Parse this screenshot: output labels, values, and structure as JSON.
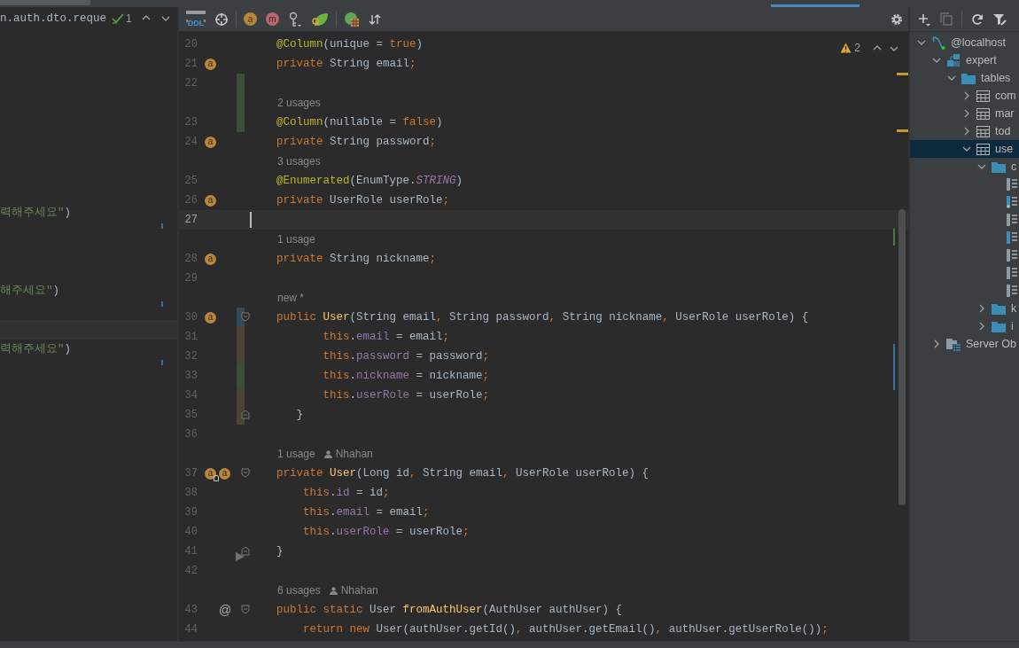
{
  "left_pane": {
    "path": "n.auth.dto.reque",
    "check_count": "1",
    "rows": [
      {
        "kind": "blank"
      },
      {
        "kind": "blank"
      },
      {
        "kind": "blank"
      },
      {
        "kind": "blank"
      },
      {
        "kind": "blank"
      },
      {
        "kind": "blank"
      },
      {
        "kind": "blank"
      },
      {
        "kind": "blank"
      },
      {
        "kind": "blank"
      },
      {
        "kind": "code",
        "tokens": [
          {
            "text": "력해주세요\"",
            "kind": "string"
          },
          {
            "text": ")",
            "kind": "plain"
          }
        ]
      },
      {
        "kind": "blank"
      },
      {
        "kind": "blank"
      },
      {
        "kind": "blank"
      },
      {
        "kind": "code",
        "tokens": [
          {
            "text": "해주세요\"",
            "kind": "string"
          },
          {
            "text": ")",
            "kind": "plain"
          }
        ]
      },
      {
        "kind": "blank"
      },
      {
        "kind": "caret_line"
      },
      {
        "kind": "code",
        "tokens": [
          {
            "text": "력해주세요\"",
            "kind": "string"
          },
          {
            "text": ")",
            "kind": "plain"
          }
        ]
      }
    ]
  },
  "toolbar": {
    "groups": [
      [
        {
          "kind": "ddl",
          "label": "DDL"
        },
        {
          "kind": "crosshair"
        }
      ],
      [
        {
          "kind": "bean",
          "label": "a"
        },
        {
          "kind": "method_bean",
          "label": "m"
        },
        {
          "kind": "key"
        },
        {
          "kind": "leaf"
        }
      ],
      [
        {
          "kind": "table_globe"
        },
        {
          "kind": "sort"
        }
      ]
    ]
  },
  "inspections": {
    "warning_count": "2"
  },
  "code_rows": [
    {
      "kind": "line",
      "number": "20",
      "current": false,
      "tokens": [
        {
          "text": "    @Column",
          "kind": "annotation"
        },
        {
          "text": "(unique = ",
          "kind": "plain"
        },
        {
          "text": "true",
          "kind": "keyword"
        },
        {
          "text": ")",
          "kind": "plain"
        }
      ]
    },
    {
      "kind": "line",
      "number": "21",
      "current": false,
      "gutter_icons": [
        {
          "kind": "bean",
          "label": "a"
        }
      ],
      "tokens": [
        {
          "text": "    private",
          "kind": "keyword"
        },
        {
          "text": " String email",
          "kind": "plain"
        },
        {
          "text": ";",
          "kind": "keyword"
        }
      ]
    },
    {
      "kind": "line",
      "number": "22",
      "current": false,
      "color": "#3a5038"
    },
    {
      "kind": "hint",
      "text": "2 usages",
      "color": "#3a5038"
    },
    {
      "kind": "line",
      "number": "23",
      "current": false,
      "color": "#3a5038",
      "tokens": [
        {
          "text": "    @Column",
          "kind": "annotation"
        },
        {
          "text": "(nullable = ",
          "kind": "plain"
        },
        {
          "text": "false",
          "kind": "keyword"
        },
        {
          "text": ")",
          "kind": "plain"
        }
      ]
    },
    {
      "kind": "line",
      "number": "24",
      "current": false,
      "gutter_icons": [
        {
          "kind": "bean",
          "label": "a"
        }
      ],
      "tokens": [
        {
          "text": "    private",
          "kind": "keyword"
        },
        {
          "text": " String password",
          "kind": "plain"
        },
        {
          "text": ";",
          "kind": "keyword"
        }
      ]
    },
    {
      "kind": "hint",
      "text": "3 usages"
    },
    {
      "kind": "line",
      "number": "25",
      "current": false,
      "tokens": [
        {
          "text": "    @Enumerated",
          "kind": "annotation"
        },
        {
          "text": "(EnumType.",
          "kind": "plain"
        },
        {
          "text": "STRING",
          "kind": "constant"
        },
        {
          "text": ")",
          "kind": "plain"
        }
      ]
    },
    {
      "kind": "line",
      "number": "26",
      "current": false,
      "gutter_icons": [
        {
          "kind": "bean",
          "label": "a"
        }
      ],
      "tokens": [
        {
          "text": "    private",
          "kind": "keyword"
        },
        {
          "text": " UserRole userRole",
          "kind": "plain"
        },
        {
          "text": ";",
          "kind": "keyword"
        }
      ]
    },
    {
      "kind": "line",
      "number": "27",
      "current": true
    },
    {
      "kind": "hint",
      "text": "1 usage"
    },
    {
      "kind": "line",
      "number": "28",
      "current": false,
      "gutter_icons": [
        {
          "kind": "bean",
          "label": "a"
        }
      ],
      "tokens": [
        {
          "text": "    private",
          "kind": "keyword"
        },
        {
          "text": " String nickname",
          "kind": "plain"
        },
        {
          "text": ";",
          "kind": "keyword"
        }
      ]
    },
    {
      "kind": "line",
      "number": "29",
      "current": false
    },
    {
      "kind": "hint",
      "text": "new *"
    },
    {
      "kind": "line",
      "number": "30",
      "current": false,
      "gutter_icons": [
        {
          "kind": "bean",
          "label": "a"
        }
      ],
      "color": "#34495a",
      "fold_start": true,
      "tokens": [
        {
          "text": "    public ",
          "kind": "keyword"
        },
        {
          "text": "User",
          "kind": "method"
        },
        {
          "text": "(String email",
          "kind": "plain"
        },
        {
          "text": ", ",
          "kind": "keyword"
        },
        {
          "text": "String password",
          "kind": "plain"
        },
        {
          "text": ", ",
          "kind": "keyword"
        },
        {
          "text": "String nickname",
          "kind": "plain"
        },
        {
          "text": ", ",
          "kind": "keyword"
        },
        {
          "text": "UserRole userRole) {",
          "kind": "plain"
        }
      ]
    },
    {
      "kind": "line",
      "number": "31",
      "current": false,
      "color": "#4b4534",
      "tokens": [
        {
          "text": "           this",
          "kind": "keyword"
        },
        {
          "text": ".",
          "kind": "plain"
        },
        {
          "text": "email",
          "kind": "field"
        },
        {
          "text": " = email",
          "kind": "plain"
        },
        {
          "text": ";",
          "kind": "keyword"
        }
      ]
    },
    {
      "kind": "line",
      "number": "32",
      "current": false,
      "color": "#4b4534",
      "tokens": [
        {
          "text": "           this",
          "kind": "keyword"
        },
        {
          "text": ".",
          "kind": "plain"
        },
        {
          "text": "password",
          "kind": "field"
        },
        {
          "text": " = password",
          "kind": "plain"
        },
        {
          "text": ";",
          "kind": "keyword"
        }
      ]
    },
    {
      "kind": "line",
      "number": "33",
      "current": false,
      "color": "#3a5038",
      "tokens": [
        {
          "text": "           this",
          "kind": "keyword"
        },
        {
          "text": ".",
          "kind": "plain"
        },
        {
          "text": "nickname",
          "kind": "field"
        },
        {
          "text": " = nickname",
          "kind": "plain"
        },
        {
          "text": ";",
          "kind": "keyword"
        }
      ]
    },
    {
      "kind": "line",
      "number": "34",
      "current": false,
      "color": "#4b4534",
      "tokens": [
        {
          "text": "           this",
          "kind": "keyword"
        },
        {
          "text": ".",
          "kind": "plain"
        },
        {
          "text": "userRole",
          "kind": "field"
        },
        {
          "text": " = userRole",
          "kind": "plain"
        },
        {
          "text": ";",
          "kind": "keyword"
        }
      ]
    },
    {
      "kind": "line",
      "number": "35",
      "current": false,
      "color": "#4b4534",
      "fold_end": true,
      "tokens": [
        {
          "text": "       }",
          "kind": "plain"
        }
      ]
    },
    {
      "kind": "line",
      "number": "36",
      "current": false
    },
    {
      "kind": "hint",
      "text": "1 usage",
      "author": "Nhahan"
    },
    {
      "kind": "line",
      "number": "37",
      "current": false,
      "gutter_icons": [
        {
          "kind": "bean_key",
          "label": "a"
        },
        {
          "kind": "bean",
          "label": "a"
        }
      ],
      "fold_start": true,
      "tokens": [
        {
          "text": "    private ",
          "kind": "keyword"
        },
        {
          "text": "User",
          "kind": "method"
        },
        {
          "text": "(Long id",
          "kind": "plain"
        },
        {
          "text": ", ",
          "kind": "keyword"
        },
        {
          "text": "String email",
          "kind": "plain"
        },
        {
          "text": ", ",
          "kind": "keyword"
        },
        {
          "text": "UserRole userRole) {",
          "kind": "plain"
        }
      ]
    },
    {
      "kind": "line",
      "number": "38",
      "current": false,
      "tokens": [
        {
          "text": "        this",
          "kind": "keyword"
        },
        {
          "text": ".",
          "kind": "plain"
        },
        {
          "text": "id",
          "kind": "field"
        },
        {
          "text": " = id",
          "kind": "plain"
        },
        {
          "text": ";",
          "kind": "keyword"
        }
      ]
    },
    {
      "kind": "line",
      "number": "39",
      "current": false,
      "tokens": [
        {
          "text": "        this",
          "kind": "keyword"
        },
        {
          "text": ".",
          "kind": "plain"
        },
        {
          "text": "email",
          "kind": "field"
        },
        {
          "text": " = email",
          "kind": "plain"
        },
        {
          "text": ";",
          "kind": "keyword"
        }
      ]
    },
    {
      "kind": "line",
      "number": "40",
      "current": false,
      "tokens": [
        {
          "text": "        this",
          "kind": "keyword"
        },
        {
          "text": ".",
          "kind": "plain"
        },
        {
          "text": "userRole",
          "kind": "field"
        },
        {
          "text": " = userRole",
          "kind": "plain"
        },
        {
          "text": ";",
          "kind": "keyword"
        }
      ]
    },
    {
      "kind": "line",
      "number": "41",
      "current": false,
      "fold_end": true,
      "arrow_marker": true,
      "tokens": [
        {
          "text": "    }",
          "kind": "plain"
        }
      ]
    },
    {
      "kind": "line",
      "number": "42",
      "current": false
    },
    {
      "kind": "hint",
      "text": "6 usages",
      "author": "Nhahan"
    },
    {
      "kind": "line",
      "number": "43",
      "current": false,
      "gutter_icons": [
        {
          "kind": "symbol",
          "label": "@"
        }
      ],
      "fold_start": true,
      "tokens": [
        {
          "text": "    public static",
          "kind": "keyword"
        },
        {
          "text": " User ",
          "kind": "plain"
        },
        {
          "text": "fromAuthUser",
          "kind": "method"
        },
        {
          "text": "(AuthUser authUser) {",
          "kind": "plain"
        }
      ]
    },
    {
      "kind": "line",
      "number": "44",
      "current": false,
      "tokens": [
        {
          "text": "        return new",
          "kind": "keyword"
        },
        {
          "text": " User(authUser.getId()",
          "kind": "plain"
        },
        {
          "text": ", ",
          "kind": "keyword"
        },
        {
          "text": "authUser.getEmail()",
          "kind": "plain"
        },
        {
          "text": ", ",
          "kind": "keyword"
        },
        {
          "text": "authUser.getUserRole())",
          "kind": "plain"
        },
        {
          "text": ";",
          "kind": "keyword"
        }
      ]
    }
  ],
  "database_toolbar": {
    "icons": [
      {
        "kind": "add",
        "disabled": false
      },
      {
        "kind": "copy",
        "disabled": true
      },
      {
        "kind": "refresh",
        "disabled": false
      },
      {
        "kind": "filter_settings",
        "disabled": false
      }
    ]
  },
  "database_tree": {
    "items": [
      {
        "kind": "server",
        "label": "@localhost",
        "expanded": true,
        "selected": false,
        "children": [
          {
            "kind": "schema",
            "label": "expert",
            "expanded": true,
            "selected": false,
            "children": [
              {
                "kind": "folder",
                "label": "tables",
                "expanded": true,
                "selected": false,
                "children": [
                  {
                    "kind": "table",
                    "label": "com",
                    "expanded": false,
                    "selected": false
                  },
                  {
                    "kind": "table",
                    "label": "mar",
                    "expanded": false,
                    "selected": false
                  },
                  {
                    "kind": "table",
                    "label": "tod",
                    "expanded": false,
                    "selected": false
                  },
                  {
                    "kind": "table",
                    "label": "use",
                    "expanded": true,
                    "selected": true,
                    "children": [
                      {
                        "kind": "folder",
                        "label": "c",
                        "expanded": true,
                        "selected": false,
                        "children": [
                          {
                            "kind": "column",
                            "selected": false
                          },
                          {
                            "kind": "key_column",
                            "selected": false
                          },
                          {
                            "kind": "column",
                            "selected": false
                          },
                          {
                            "kind": "indexed_column",
                            "selected": false
                          },
                          {
                            "kind": "column",
                            "selected": false
                          },
                          {
                            "kind": "column",
                            "selected": false
                          },
                          {
                            "kind": "column",
                            "selected": false
                          }
                        ]
                      },
                      {
                        "kind": "folder",
                        "label": "k",
                        "expanded": false,
                        "selected": false
                      },
                      {
                        "kind": "folder",
                        "label": "i",
                        "expanded": false,
                        "selected": false
                      }
                    ]
                  }
                ]
              }
            ]
          },
          {
            "kind": "server_objects",
            "label": "Server Ob",
            "expanded": false,
            "selected": false
          }
        ]
      }
    ]
  }
}
